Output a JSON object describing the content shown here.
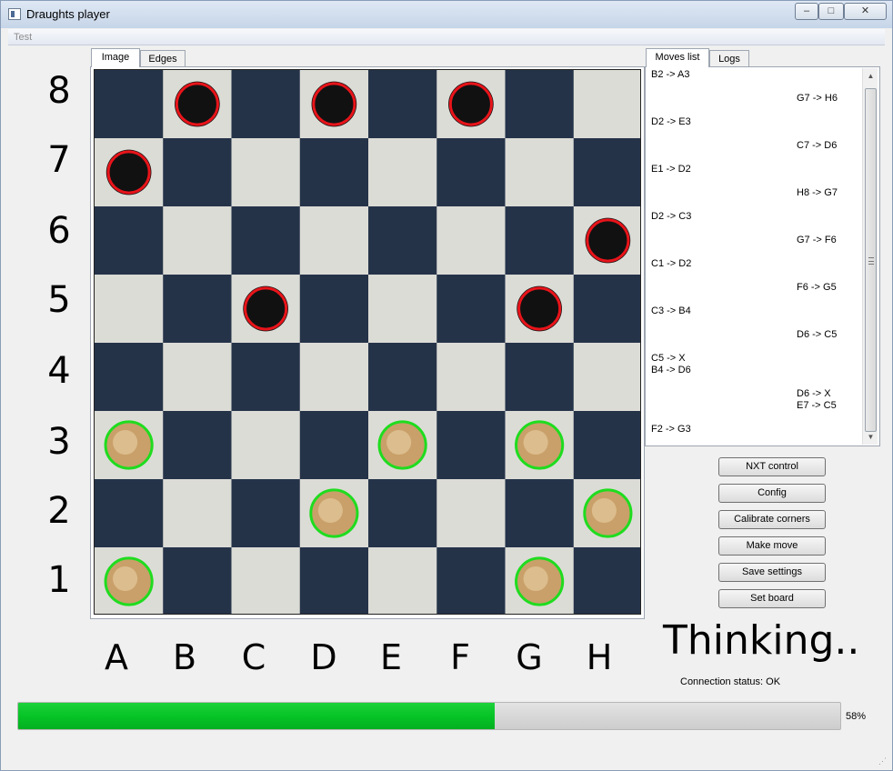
{
  "window": {
    "title": "Draughts player",
    "minimize": "–",
    "maximize": "□",
    "close": "✕"
  },
  "menu": {
    "items": [
      "Test"
    ]
  },
  "tabs_left": [
    "Image",
    "Edges"
  ],
  "tabs_right": [
    "Moves list",
    "Logs"
  ],
  "row_labels": [
    "8",
    "7",
    "6",
    "5",
    "4",
    "3",
    "2",
    "1"
  ],
  "col_labels": [
    "A",
    "B",
    "C",
    "D",
    "E",
    "F",
    "G",
    "H"
  ],
  "board": {
    "black_pieces": [
      "B8",
      "D8",
      "F8",
      "A7",
      "H6",
      "C5",
      "G5"
    ],
    "white_pieces": [
      "A3",
      "E3",
      "G3",
      "D2",
      "H2",
      "A1",
      "G1"
    ],
    "black_marker_color": "#e8141a",
    "white_marker_color": "#1fdc1f"
  },
  "moves": [
    {
      "player": "left",
      "text": "B2 -> A3"
    },
    {
      "player": "right",
      "text": "G7 -> H6"
    },
    {
      "player": "left",
      "text": "D2 -> E3"
    },
    {
      "player": "right",
      "text": "C7 -> D6"
    },
    {
      "player": "left",
      "text": "E1 -> D2"
    },
    {
      "player": "right",
      "text": "H8 -> G7"
    },
    {
      "player": "left",
      "text": "D2 -> C3"
    },
    {
      "player": "right",
      "text": "G7 -> F6"
    },
    {
      "player": "left",
      "text": "C1 -> D2"
    },
    {
      "player": "right",
      "text": "F6 -> G5"
    },
    {
      "player": "left",
      "text": "C3 -> B4"
    },
    {
      "player": "right",
      "text": "D6 -> C5"
    },
    {
      "player": "left",
      "text": "C5 -> X"
    },
    {
      "player": "left",
      "text": "B4 -> D6"
    },
    {
      "player": "right",
      "text": "D6 -> X"
    },
    {
      "player": "right",
      "text": "E7 -> C5"
    },
    {
      "player": "left",
      "text": "F2 -> G3"
    }
  ],
  "buttons": {
    "nxt_control": "NXT control",
    "config": "Config",
    "calibrate_corners": "Calibrate corners",
    "make_move": "Make move",
    "save_settings": "Save settings",
    "set_board": "Set board"
  },
  "status": {
    "thinking": "Thinking..",
    "connection": "Connection status: OK"
  },
  "progress": {
    "value": 58,
    "label": "58%",
    "color": "#06c427"
  }
}
